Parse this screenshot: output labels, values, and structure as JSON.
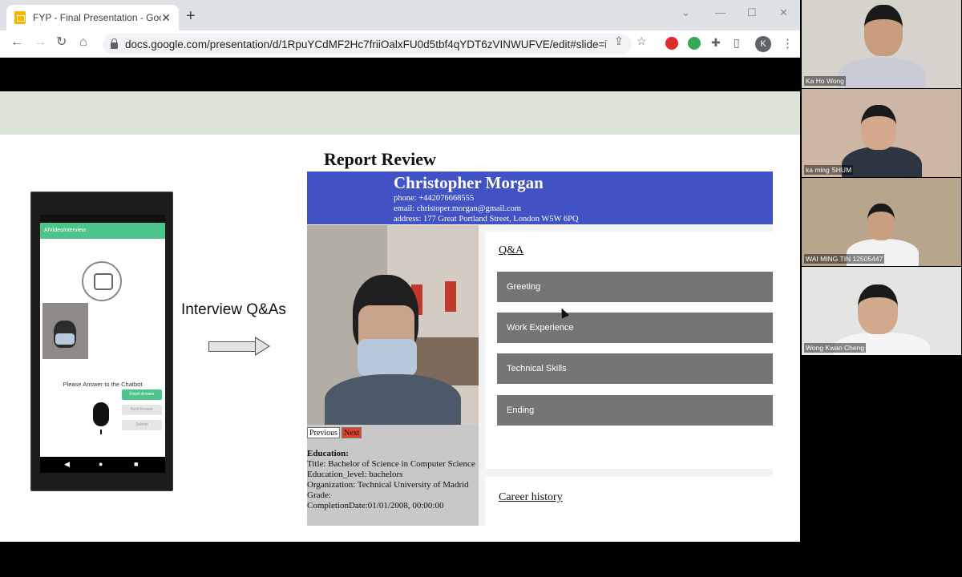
{
  "browser": {
    "tab_title": "FYP - Final Presentation - Goo",
    "url": "docs.google.com/presentation/d/1RpuYCdMF2Hc7friiOalxFU0d5tbf4qYDT6zVINWUFVE/edit#slide=i...",
    "profile_initial": "K"
  },
  "slide": {
    "interview_label": "Interview Q&As",
    "phone": {
      "app_title": "AiVideoInterview",
      "prompt": "Please Answer to the Chatbot",
      "buttons": [
        "Finish Answer",
        "Next Answer",
        "Submit"
      ]
    },
    "report": {
      "title": "Report Review",
      "name": "Christopher Morgan",
      "phone": "phone: +442076668555",
      "email": "email: christoper.morgan@gmail.com",
      "address": "address: 177 Great Portland Street, London W5W 6PQ",
      "prev_label": "Previous",
      "next_label": "Next",
      "education_heading": "Education:",
      "education_lines": [
        "Title: Bachelor of Science in Computer Science",
        "Education_level: bachelors",
        "Organization: Technical University of Madrid",
        "Grade:",
        "CompletionDate:01/01/2008, 00:00:00"
      ],
      "qa_title": "Q&A",
      "qa_items": [
        "Greeting",
        "Work Experience",
        "Technical Skills",
        "Ending"
      ],
      "career_title": "Career history"
    }
  },
  "participants": [
    {
      "name": "Ka Ho Wong"
    },
    {
      "name": "ka ming SHUM"
    },
    {
      "name": "WAI MING TIN 12505447"
    },
    {
      "name": "Wong Kwan Cheng"
    }
  ],
  "colors": {
    "report_header": "#4152c4",
    "qa_item": "#757575",
    "next_button": "#e0442b",
    "app_bar": "#4cc48b",
    "slide_band": "#dde5d6"
  }
}
